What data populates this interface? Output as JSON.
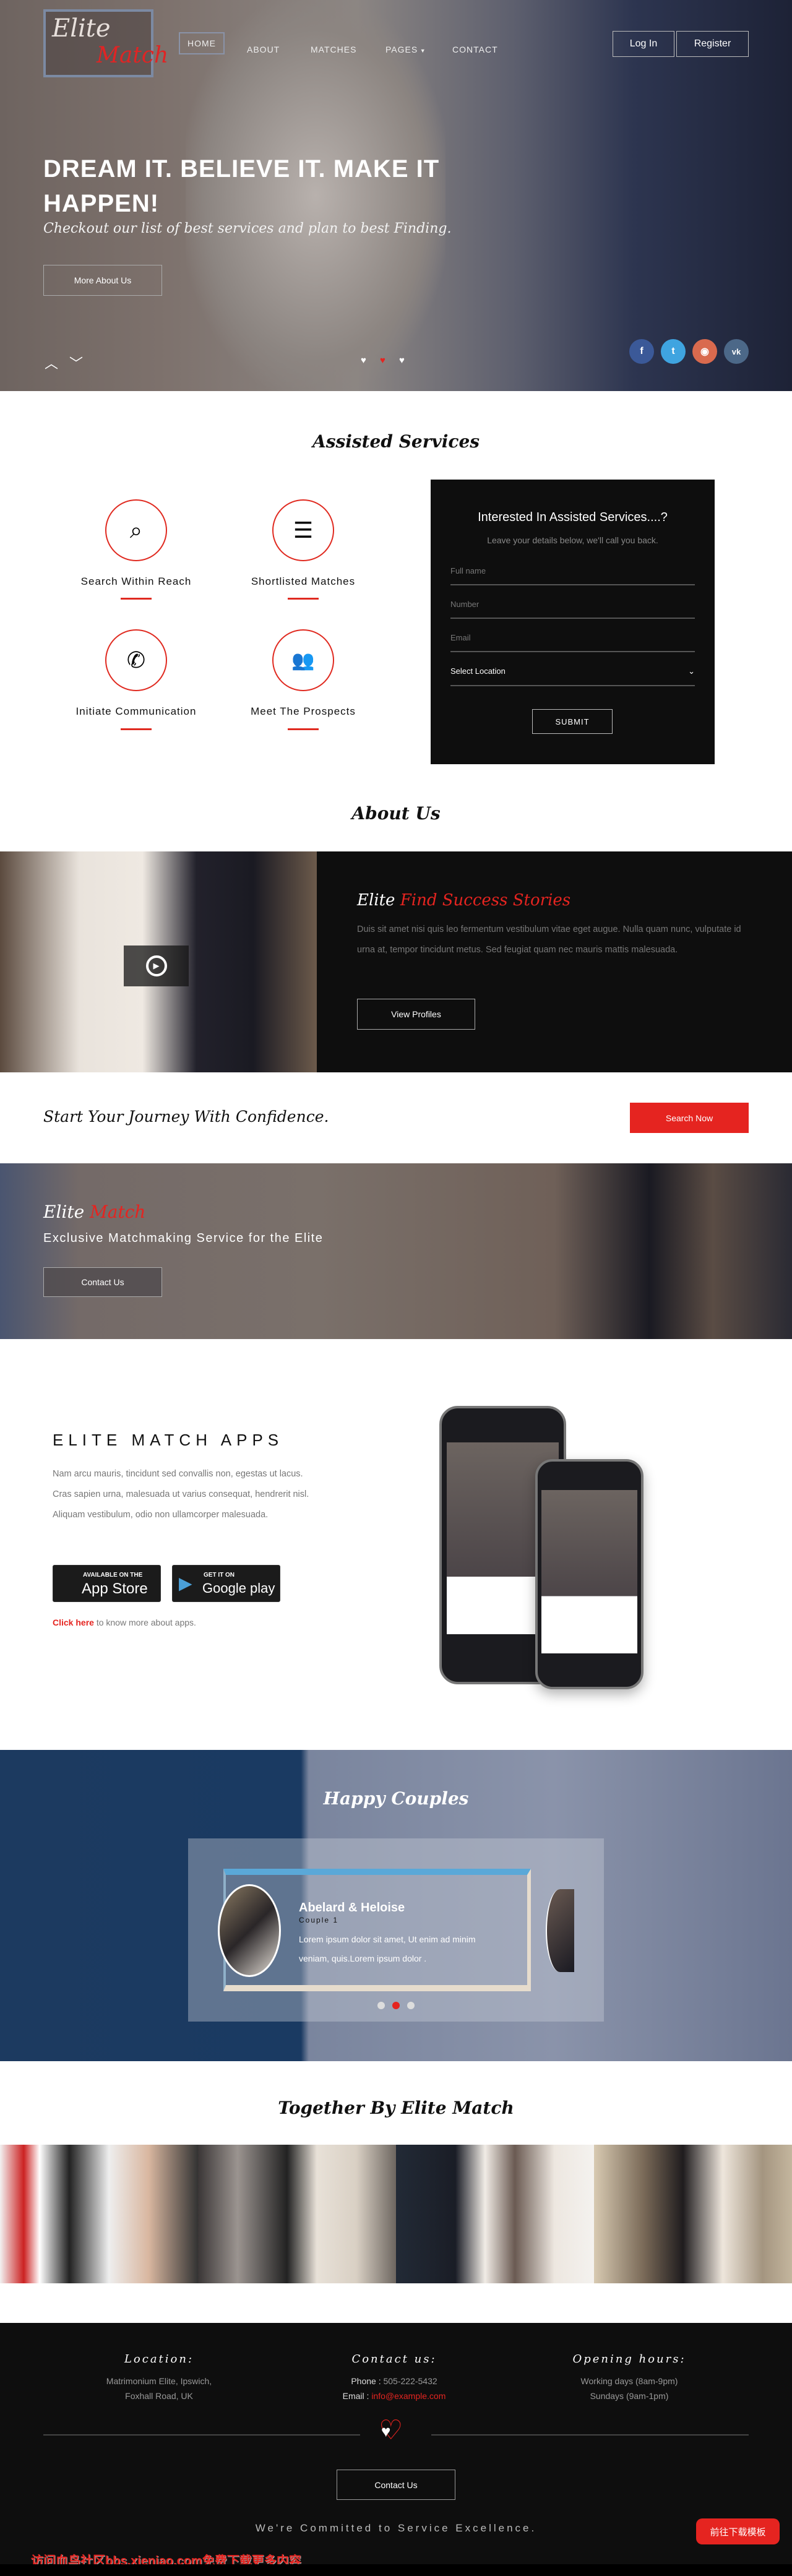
{
  "brand": {
    "elite": "Elite",
    "match": "Match"
  },
  "nav": {
    "items": [
      "HOME",
      "ABOUT",
      "MATCHES",
      "PAGES",
      "CONTACT"
    ],
    "active": "HOME",
    "login": "Log In",
    "register": "Register"
  },
  "hero": {
    "headline": "DREAM IT. BELIEVE IT. MAKE IT HAPPEN!",
    "subtitle": "Checkout our list of best services and plan to best Finding.",
    "button": "More About Us",
    "active_slide": 2,
    "slides": 3,
    "social": [
      {
        "icon": "facebook-icon",
        "glyph": "f",
        "color": "#3b5998"
      },
      {
        "icon": "twitter-icon",
        "glyph": "t",
        "color": "#3fa4e0"
      },
      {
        "icon": "rss-icon",
        "glyph": "◉",
        "color": "#d96a4e"
      },
      {
        "icon": "vk-icon",
        "glyph": "vk",
        "color": "#4c6888"
      }
    ]
  },
  "services": {
    "title": "Assisted Services",
    "items": [
      {
        "label": "Search Within Reach",
        "icon": "search-icon"
      },
      {
        "label": "Shortlisted Matches",
        "icon": "list-icon"
      },
      {
        "label": "Initiate Communication",
        "icon": "phone-icon"
      },
      {
        "label": "Meet The Prospects",
        "icon": "users-icon"
      }
    ],
    "form": {
      "title": "Interested In Assisted Services....?",
      "subtitle": "Leave your details below, we'll call you back.",
      "fullname_placeholder": "Full name",
      "number_placeholder": "Number",
      "email_placeholder": "Email",
      "location_value": "Select Location",
      "submit": "SUBMIT"
    }
  },
  "about": {
    "title": "About Us",
    "heading_white": "Elite",
    "heading_red": "Find Success Stories",
    "text": "Duis sit amet nisi quis leo fermentum vestibulum vitae eget augue. Nulla quam nunc, vulputate id urna at, tempor tincidunt metus. Sed feugiat quam nec mauris mattis malesuada.",
    "button": "View Profiles"
  },
  "journey": {
    "text": "Start Your Journey With Confidence.",
    "button": "Search Now"
  },
  "banner": {
    "elite": "Elite",
    "match": "Match",
    "tagline": "Exclusive Matchmaking Service for the Elite",
    "button": "Contact Us"
  },
  "apps": {
    "title": "ELITE MATCH APPS",
    "text": "Nam arcu mauris, tincidunt sed convallis non, egestas ut lacus. Cras sapien urna, malesuada ut varius consequat, hendrerit nisl. Aliquam vestibulum, odio non ullamcorper malesuada.",
    "appstore_small": "AVAILABLE ON THE",
    "appstore_big": "App Store",
    "google_small": "GET IT ON",
    "google_big": "Google play",
    "click_here": "Click here",
    "click_rest": " to know more about apps."
  },
  "couples": {
    "title": "Happy Couples",
    "name": "Abelard & Heloise",
    "subtitle": "Couple 1",
    "text": "Lorem ipsum dolor sit amet, Ut enim ad minim veniam, quis.Lorem ipsum dolor .",
    "active_dot": 2,
    "dots": 3
  },
  "together": {
    "title": "Together By Elite Match"
  },
  "footer": {
    "location": {
      "title": "Location:",
      "line1": "Matrimonium Elite, Ipswich,",
      "line2": "Foxhall Road, UK"
    },
    "contact": {
      "title": "Contact us:",
      "phone_label": "Phone :",
      "phone": "505-222-5432",
      "email_label": "Email :",
      "email": "info@example.com"
    },
    "hours": {
      "title": "Opening hours:",
      "line1": "Working days (8am-9pm)",
      "line2": "Sundays (9am-1pm)"
    },
    "button": "Contact Us",
    "tagline": "We're Committed to Service Excellence.",
    "download": "前往下载模板",
    "watermark": "访问血鸟社区bbs.xieniao.com免费下载更多内容"
  },
  "colors": {
    "accent": "#e52420",
    "dark": "#0e0e0e"
  }
}
